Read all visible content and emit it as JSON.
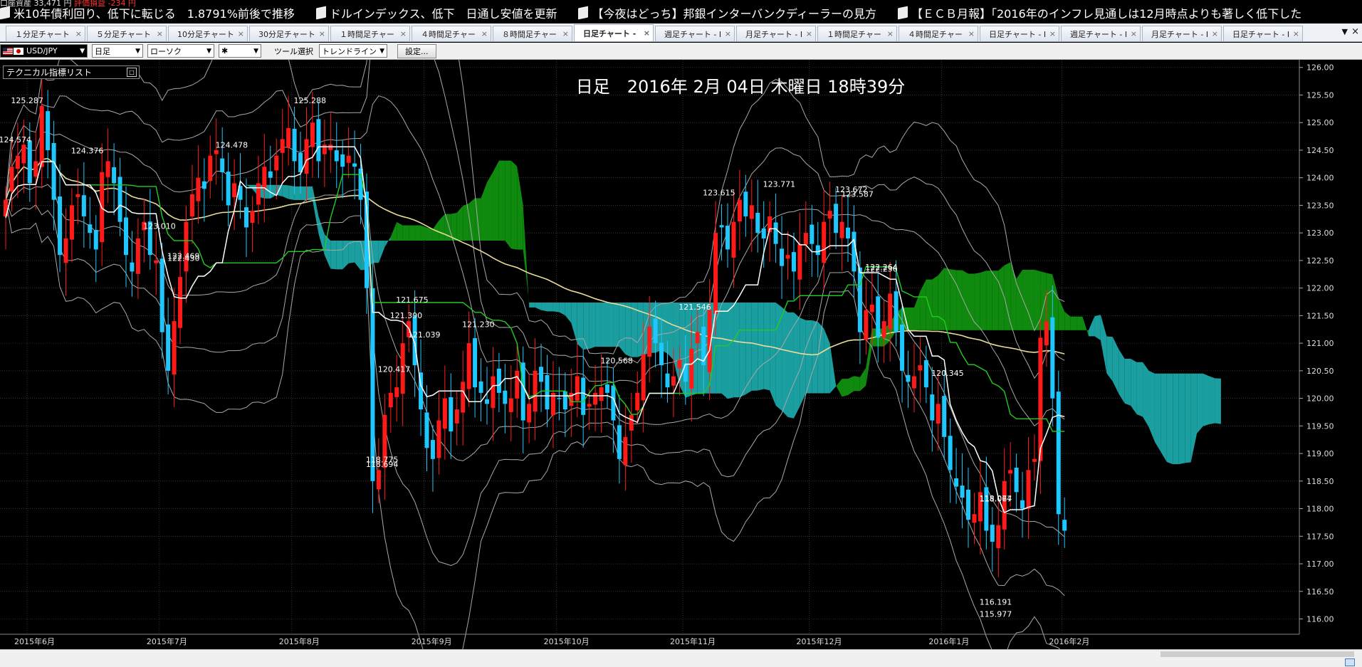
{
  "ticker": {
    "top_row_prefix": "口座資産 33,471 円",
    "top_row_red": "評価損益 -234 円",
    "items": [
      "米10年債利回り、低下に転じる　1.8791%前後で推移",
      "ドルインデックス、低下　日通し安値を更新",
      "【今夜はどっち】邦銀インターバンクディーラーの見方",
      "【ＥＣＢ月報】「2016年のインフレ見通しは12月時点よりも著しく低下した"
    ]
  },
  "tabs": [
    {
      "label": "１分足チャート",
      "active": false
    },
    {
      "label": "５分足チャート",
      "active": false
    },
    {
      "label": "10分足チャート",
      "active": false
    },
    {
      "label": "30分足チャート",
      "active": false
    },
    {
      "label": "１時間足チャー",
      "active": false
    },
    {
      "label": "４時間足チャー",
      "active": false
    },
    {
      "label": "８時間足チャー",
      "active": false
    },
    {
      "label": "日足チャート -",
      "active": true
    },
    {
      "label": "週足チャート - I",
      "active": false
    },
    {
      "label": "月足チャート - I",
      "active": false
    },
    {
      "label": "１時間足チャー",
      "active": false
    },
    {
      "label": "４時間足チャー",
      "active": false
    },
    {
      "label": "日足チャート - I",
      "active": false
    },
    {
      "label": "週足チャート - I",
      "active": false
    },
    {
      "label": "月足チャート - I",
      "active": false
    },
    {
      "label": "日足チャート - I",
      "active": false
    }
  ],
  "tab_menu_glyph": "▼",
  "tab_close_glyph": "×",
  "toolbar": {
    "pair": "USD/JPY",
    "timeframe": "日足",
    "chart_type": "ローソク",
    "drawing_mode": "✱",
    "tool_select_label": "ツール選択",
    "tool": "トレンドライン",
    "settings_label": "設定..."
  },
  "indicator_panel": {
    "title": "テクニカル指標リスト",
    "button": "□"
  },
  "colors": {
    "bull": "#ff1a1a",
    "bear": "#1ec8ff",
    "kumo_bull": "#0f8a0f",
    "kumo_bear": "#1a9ea0",
    "tenkan": "#ffffff",
    "kijun": "#22cc22",
    "ma_long": "#e8dc9a",
    "bollinger": "#a8a8a8"
  },
  "chart_data": {
    "type": "candlestick",
    "title": "日足　2016年 2月 04日 木曜日 18時39分",
    "ylim": [
      115.8,
      126.1
    ],
    "y_ticks": [
      "126.00",
      "125.50",
      "125.00",
      "124.50",
      "124.00",
      "123.50",
      "123.00",
      "122.50",
      "122.00",
      "121.50",
      "121.00",
      "120.50",
      "120.00",
      "119.50",
      "119.00",
      "118.50",
      "118.00",
      "117.50",
      "117.00",
      "116.50",
      "116.00"
    ],
    "x_labels": [
      "2015年6月",
      "2015年7月",
      "2015年8月",
      "2015年9月",
      "2015年10月",
      "2015年11月",
      "2015年12月",
      "2016年1月",
      "2016年2月"
    ],
    "annotations": [
      "125.287",
      "124.574",
      "124.376",
      "122.469",
      "122.430",
      "120.417",
      "124.478",
      "123.010",
      "125.288",
      "121.675",
      "121.390",
      "121.039",
      "121.230",
      "118.775",
      "118.067",
      "118.694",
      "120.568",
      "118.074",
      "121.546",
      "123.615",
      "123.771",
      "122.236",
      "122.264",
      "123.672",
      "123.587",
      "120.345",
      "115.977",
      "116.191"
    ],
    "closes": [
      123.6,
      124.2,
      124.4,
      124.6,
      123.9,
      124.3,
      125.3,
      124.5,
      123.6,
      122.6,
      122.9,
      123.5,
      123.7,
      123.3,
      123.0,
      122.7,
      124.1,
      124.3,
      123.9,
      123.2,
      122.6,
      122.3,
      122.9,
      123.2,
      122.6,
      122.5,
      121.2,
      120.5,
      121.4,
      122.2,
      123.2,
      123.7,
      124.0,
      123.8,
      124.4,
      124.5,
      124.1,
      123.5,
      123.9,
      123.6,
      123.1,
      123.4,
      123.9,
      124.2,
      124.0,
      124.4,
      124.7,
      124.9,
      124.3,
      124.1,
      124.7,
      125.0,
      124.3,
      124.6,
      124.6,
      124.3,
      124.2,
      124.4,
      124.2,
      123.6,
      122.0,
      118.5,
      118.7,
      119.7,
      120.1,
      120.2,
      121.0,
      121.4,
      120.6,
      119.8,
      119.1,
      118.9,
      119.6,
      120.0,
      119.4,
      119.8,
      120.3,
      121.0,
      120.2,
      120.1,
      119.9,
      120.4,
      120.1,
      119.9,
      120.0,
      120.5,
      119.6,
      119.9,
      120.5,
      120.3,
      119.8,
      120.1,
      120.0,
      119.8,
      120.1,
      120.4,
      119.7,
      119.9,
      120.1,
      120.2,
      120.1,
      119.6,
      118.9,
      119.3,
      119.7,
      120.1,
      120.8,
      121.3,
      121.0,
      120.6,
      120.2,
      120.4,
      120.7,
      120.3,
      120.9,
      121.2,
      120.6,
      121.6,
      123.0,
      123.1,
      122.7,
      123.2,
      123.6,
      123.3,
      123.5,
      123.0,
      122.9,
      123.3,
      122.8,
      122.4,
      122.6,
      122.3,
      122.8,
      123.0,
      122.8,
      122.6,
      123.2,
      123.4,
      123.0,
      123.2,
      122.9,
      122.3,
      121.2,
      121.6,
      121.7,
      121.1,
      121.4,
      121.9,
      121.2,
      120.5,
      120.3,
      120.4,
      120.6,
      120.2,
      119.6,
      119.9,
      119.3,
      118.7,
      118.4,
      118.2,
      117.8,
      117.9,
      118.3,
      117.6,
      117.4,
      117.7,
      118.5,
      118.7,
      118.3,
      118.0,
      118.7,
      118.9,
      121.1,
      121.4,
      120.0,
      117.9,
      117.6
    ]
  }
}
